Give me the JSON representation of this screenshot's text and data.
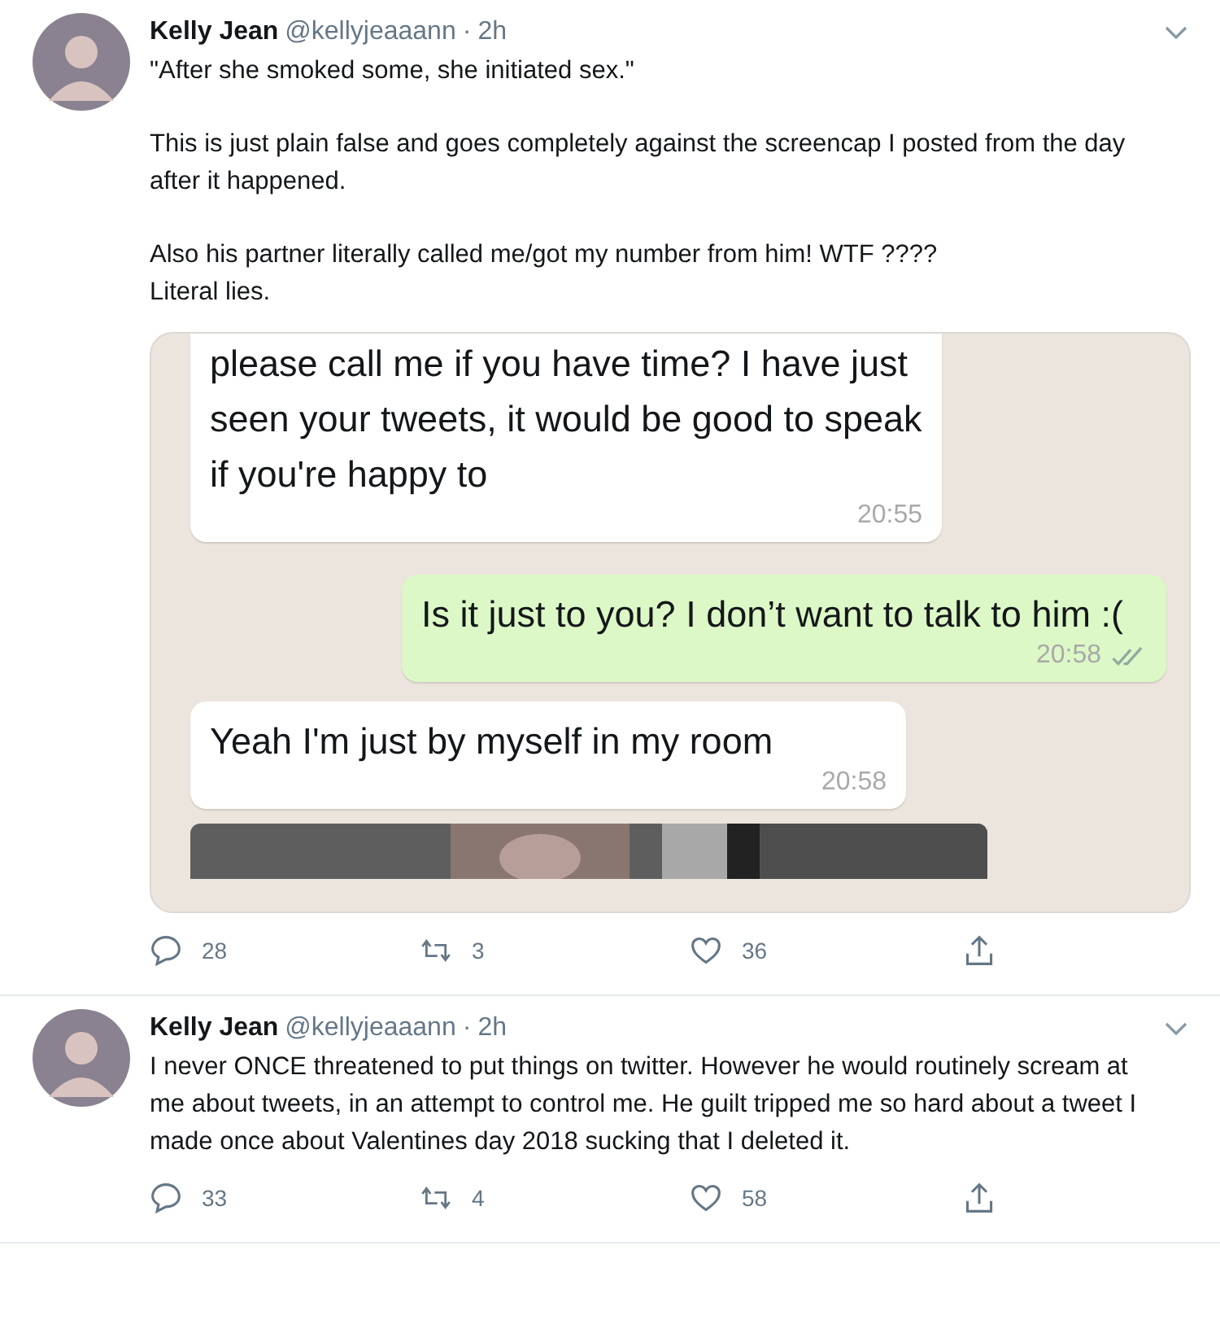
{
  "tweets": [
    {
      "name": "Kelly Jean",
      "handle": "@kellyjeaaann",
      "separator": "·",
      "time": "2h",
      "paragraphs": [
        "\"After she smoked some, she initiated sex.\"",
        "This is just plain false and goes completely against the screencap I posted from the day after it happened.",
        "Also his partner literally called me/got my number from him! WTF ????\nLiteral lies."
      ],
      "chat": [
        {
          "kind": "incoming",
          "text": "please call me if you have time? I have just seen your tweets, it would be good to speak if you're happy to",
          "time": "20:55",
          "ticks": false
        },
        {
          "kind": "outgoing",
          "text": "Is it just to you? I don’t want to talk to him :(",
          "time": "20:58",
          "ticks": true
        },
        {
          "kind": "incoming",
          "text": "Yeah I'm just by myself in my room",
          "time": "20:58",
          "ticks": false
        },
        {
          "kind": "picture"
        }
      ],
      "replies": "28",
      "retweets": "3",
      "likes": "36"
    },
    {
      "name": "Kelly Jean",
      "handle": "@kellyjeaaann",
      "separator": "·",
      "time": "2h",
      "paragraphs": [
        "I never ONCE threatened to put things on twitter. However he would routinely scream at me about tweets, in an attempt to control  me. He guilt tripped me so hard about a tweet I made once about Valentines day 2018 sucking that I deleted it."
      ],
      "replies": "33",
      "retweets": "4",
      "likes": "58"
    }
  ]
}
